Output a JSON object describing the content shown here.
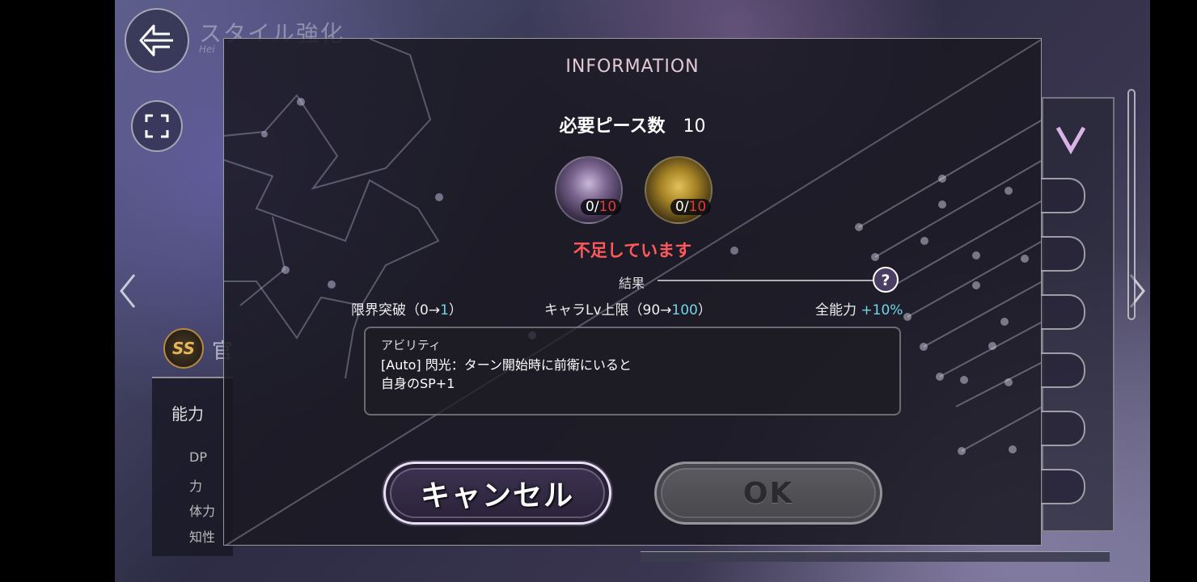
{
  "background": {
    "screen_title": "スタイル強化",
    "screen_subtitle": "Hei",
    "style_rank": "SS",
    "style_name_partial": "官",
    "stats_panel": {
      "header": "能力",
      "rows": [
        "DP",
        "力",
        "体力",
        "知性"
      ]
    }
  },
  "modal": {
    "title": "INFORMATION",
    "required_label": "必要ピース数",
    "required_count": "10",
    "items": [
      {
        "icon": "character-piece-icon",
        "have": "0/",
        "need": "10"
      },
      {
        "icon": "universal-piece-icon",
        "have": "0/",
        "need": "10"
      }
    ],
    "warning": "不足しています",
    "result_label": "結果",
    "results": [
      {
        "label": "限界突破（0→",
        "value": "1",
        "suffix": "）"
      },
      {
        "label": "キャラLv上限（90→",
        "value": "100",
        "suffix": "）"
      },
      {
        "label": "全能力 ",
        "value": "+10%",
        "suffix": ""
      }
    ],
    "ability": {
      "title": "アビリティ",
      "text": "[Auto] 閃光：ターン開始時に前衛にいると\n自身のSP+1"
    },
    "cancel_label": "キャンセル",
    "ok_label": "OK"
  },
  "colors": {
    "warning": "#ff5a5a",
    "highlight": "#6fd6e6",
    "shortage": "#e23a3a"
  }
}
